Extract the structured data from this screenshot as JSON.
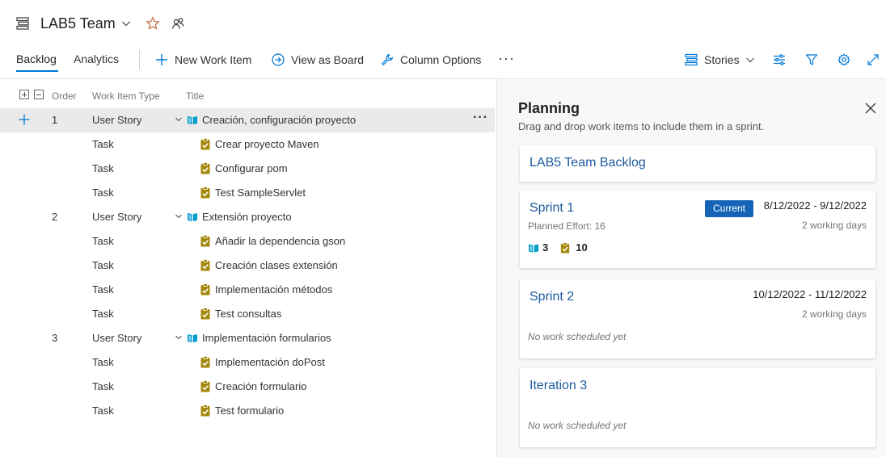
{
  "header": {
    "team_name": "LAB5 Team",
    "tabs": [
      {
        "label": "Backlog",
        "active": true
      },
      {
        "label": "Analytics",
        "active": false
      }
    ],
    "actions": {
      "new_work_item": "New Work Item",
      "view_as_board": "View as Board",
      "column_options": "Column Options",
      "more": "···"
    },
    "level_selector": "Stories"
  },
  "grid": {
    "columns": {
      "order": "Order",
      "type": "Work Item Type",
      "title": "Title"
    },
    "rows": [
      {
        "order": "1",
        "type": "User Story",
        "title": "Creación, configuración proyecto"
      },
      {
        "order": "",
        "type": "Task",
        "title": "Crear proyecto Maven"
      },
      {
        "order": "",
        "type": "Task",
        "title": "Configurar pom"
      },
      {
        "order": "",
        "type": "Task",
        "title": "Test SampleServlet"
      },
      {
        "order": "2",
        "type": "User Story",
        "title": "Extensión proyecto"
      },
      {
        "order": "",
        "type": "Task",
        "title": "Añadir la dependencia gson"
      },
      {
        "order": "",
        "type": "Task",
        "title": "Creación clases extensión"
      },
      {
        "order": "",
        "type": "Task",
        "title": "Implementación métodos"
      },
      {
        "order": "",
        "type": "Task",
        "title": "Test consultas"
      },
      {
        "order": "3",
        "type": "User Story",
        "title": "Implementación formularios"
      },
      {
        "order": "",
        "type": "Task",
        "title": "Implementación doPost"
      },
      {
        "order": "",
        "type": "Task",
        "title": "Creación formulario"
      },
      {
        "order": "",
        "type": "Task",
        "title": "Test formulario"
      }
    ],
    "row_more": "···"
  },
  "planning": {
    "title": "Planning",
    "subtitle": "Drag and drop work items to include them in a sprint.",
    "backlog_card": "LAB5 Team Backlog",
    "sprint1": {
      "name": "Sprint 1",
      "badge": "Current",
      "dates": "8/12/2022 - 9/12/2022",
      "days": "2 working days",
      "effort": "Planned Effort: 16",
      "stories_count": "3",
      "tasks_count": "10"
    },
    "sprint2": {
      "name": "Sprint 2",
      "dates": "10/12/2022 - 11/12/2022",
      "days": "2 working days",
      "empty": "No work scheduled yet"
    },
    "iteration3": {
      "name": "Iteration 3",
      "empty": "No work scheduled yet"
    }
  },
  "colors": {
    "accent": "#0078d4",
    "story_icon": "#009ccc",
    "task_icon": "#a4880a",
    "badge": "#1664b8",
    "link": "#1e5aa0"
  }
}
